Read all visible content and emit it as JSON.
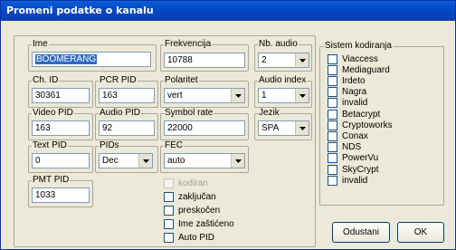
{
  "window": {
    "title": "Promeni podatke o kanalu"
  },
  "fields": {
    "ime": {
      "label": "Ime",
      "value": "BOOMERANG"
    },
    "frekvencija": {
      "label": "Frekvencija",
      "value": "10788"
    },
    "nb_audio": {
      "label": "Nb. audio",
      "value": "2"
    },
    "ch_id": {
      "label": "Ch. ID",
      "value": "30361"
    },
    "pcr_pid": {
      "label": "PCR PID",
      "value": "163"
    },
    "polaritet": {
      "label": "Polaritet",
      "value": "vert"
    },
    "audio_index": {
      "label": "Audio index",
      "value": "1"
    },
    "video_pid": {
      "label": "Video PID",
      "value": "163"
    },
    "audio_pid": {
      "label": "Audio PID",
      "value": "92"
    },
    "symbol_rate": {
      "label": "Symbol rate",
      "value": "22000"
    },
    "jezik": {
      "label": "Jezik",
      "value": "SPA"
    },
    "text_pid": {
      "label": "Text PID",
      "value": "0"
    },
    "pids": {
      "label": "PIDs",
      "value": "Dec"
    },
    "fec": {
      "label": "FEC",
      "value": "auto"
    },
    "pmt_pid": {
      "label": "PMT PID",
      "value": "1033"
    }
  },
  "flags": [
    {
      "label": "kodiran",
      "checked": false,
      "disabled": true
    },
    {
      "label": "zaključan",
      "checked": false,
      "disabled": false
    },
    {
      "label": "preskočen",
      "checked": false,
      "disabled": false
    },
    {
      "label": "Ime zaštićeno",
      "checked": false,
      "disabled": false
    },
    {
      "label": "Auto PID",
      "checked": false,
      "disabled": false
    }
  ],
  "encryption": {
    "label": "Sistem kodiranja",
    "items": [
      "Viaccess",
      "Mediaguard",
      "Irdeto",
      "Nagra",
      "invalid",
      "Betacrypt",
      "Cryptoworks",
      "Conax",
      "NDS",
      "PowerVu",
      "SkyCrypt",
      "invalid"
    ]
  },
  "buttons": {
    "cancel": "Odustani",
    "ok": "OK"
  }
}
